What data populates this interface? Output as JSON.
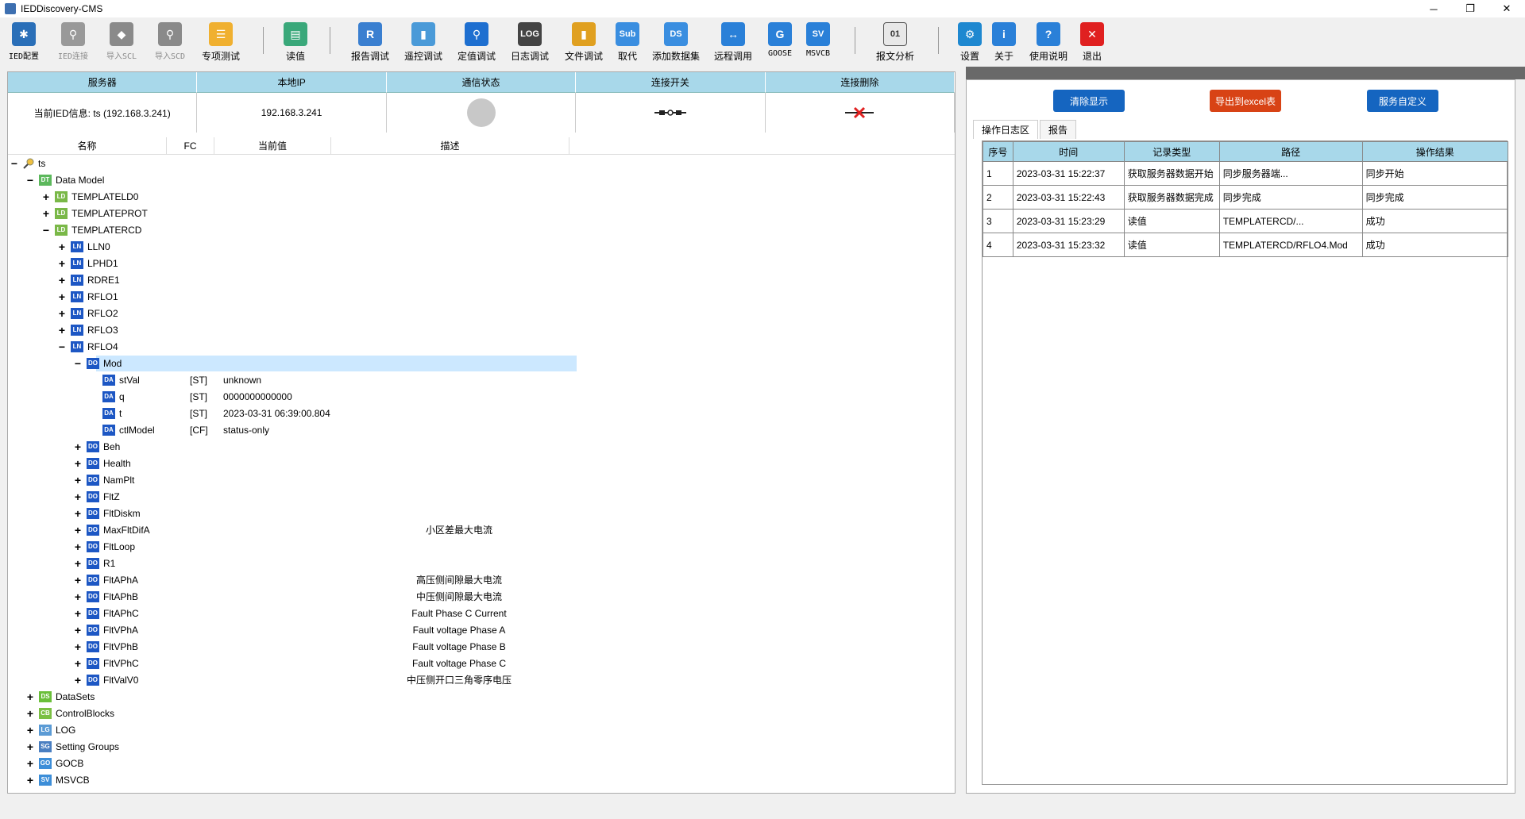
{
  "window": {
    "title": "IEDDiscovery-CMS",
    "min": "─",
    "max": "❐",
    "close": "✕"
  },
  "toolbar": [
    {
      "label": "IED配置",
      "icon": "ied-config-icon",
      "color": "#2a6fb8",
      "glyph": "✱",
      "enabled": true,
      "mono": true
    },
    {
      "label": "IED连接",
      "icon": "ied-connect-icon",
      "color": "#999999",
      "glyph": "⚲",
      "enabled": false,
      "mono": true
    },
    {
      "label": "导入SCL",
      "icon": "import-scl-icon",
      "color": "#8a8a8a",
      "glyph": "◆",
      "enabled": false,
      "mono": true
    },
    {
      "label": "导入SCD",
      "icon": "import-scd-icon",
      "color": "#8a8a8a",
      "glyph": "⚲",
      "enabled": false,
      "mono": true
    },
    {
      "label": "专项测试",
      "icon": "special-test-icon",
      "color": "#f0b030",
      "glyph": "☰",
      "enabled": true,
      "mono": false
    },
    {
      "label": "读值",
      "icon": "read-value-icon",
      "color": "#3aa87a",
      "glyph": "▤",
      "enabled": true,
      "mono": false
    },
    {
      "label": "报告调试",
      "icon": "report-debug-icon",
      "color": "#3a7fd0",
      "glyph": "R",
      "enabled": true,
      "mono": false
    },
    {
      "label": "遥控调试",
      "icon": "remote-control-icon",
      "color": "#4a9ad8",
      "glyph": "▮",
      "enabled": true,
      "mono": false
    },
    {
      "label": "定值调试",
      "icon": "setting-value-icon",
      "color": "#1e6fd0",
      "glyph": "⚲",
      "enabled": true,
      "mono": false
    },
    {
      "label": "日志调试",
      "icon": "log-debug-icon",
      "color": "#444444",
      "glyph": "LOG",
      "enabled": true,
      "mono": false
    },
    {
      "label": "文件调试",
      "icon": "file-debug-icon",
      "color": "#e0a020",
      "glyph": "▮",
      "enabled": true,
      "mono": false
    },
    {
      "label": "取代",
      "icon": "substitute-icon",
      "color": "#3a8ee0",
      "glyph": "Sub",
      "enabled": true,
      "mono": false
    },
    {
      "label": "添加数据集",
      "icon": "add-dataset-icon",
      "color": "#3a8ee0",
      "glyph": "DS",
      "enabled": true,
      "mono": false
    },
    {
      "label": "远程调用",
      "icon": "remote-call-icon",
      "color": "#2a80d8",
      "glyph": "↔",
      "enabled": true,
      "mono": false
    },
    {
      "label": "GOOSE",
      "icon": "goose-icon",
      "color": "#2a80d8",
      "glyph": "G",
      "enabled": true,
      "mono": true
    },
    {
      "label": "MSVCB",
      "icon": "msvcb-icon",
      "color": "#2a80d8",
      "glyph": "SV",
      "enabled": true,
      "mono": true
    },
    {
      "label": "报文分析",
      "icon": "message-analysis-icon",
      "color": "#e8e8e8",
      "glyph": "01",
      "enabled": true,
      "mono": false
    },
    {
      "label": "设置",
      "icon": "settings-icon",
      "color": "#1e88d0",
      "glyph": "⚙",
      "enabled": true,
      "mono": false
    },
    {
      "label": "关于",
      "icon": "about-icon",
      "color": "#2a80d8",
      "glyph": "i",
      "enabled": true,
      "mono": false
    },
    {
      "label": "使用说明",
      "icon": "help-icon",
      "color": "#2a80d8",
      "glyph": "?",
      "enabled": true,
      "mono": false
    },
    {
      "label": "退出",
      "icon": "exit-icon",
      "color": "#e02020",
      "glyph": "✕",
      "enabled": true,
      "mono": false
    }
  ],
  "connection": {
    "headers": [
      "服务器",
      "本地IP",
      "通信状态",
      "连接开关",
      "连接删除"
    ],
    "server": "当前IED信息: ts (192.168.3.241)",
    "local_ip": "192.168.3.241"
  },
  "tree_headers": [
    "名称",
    "FC",
    "当前值",
    "描述"
  ],
  "tree": [
    {
      "level": 0,
      "exp": "−",
      "badge": "",
      "name": "ts"
    },
    {
      "level": 1,
      "exp": "−",
      "badge": "DT",
      "name": "Data Model"
    },
    {
      "level": 2,
      "exp": "+",
      "badge": "LD",
      "name": "TEMPLATELD0"
    },
    {
      "level": 2,
      "exp": "+",
      "badge": "LD",
      "name": "TEMPLATEPROT"
    },
    {
      "level": 2,
      "exp": "−",
      "badge": "LD",
      "name": "TEMPLATERCD"
    },
    {
      "level": 3,
      "exp": "+",
      "badge": "LN",
      "name": "LLN0"
    },
    {
      "level": 3,
      "exp": "+",
      "badge": "LN",
      "name": "LPHD1"
    },
    {
      "level": 3,
      "exp": "+",
      "badge": "LN",
      "name": "RDRE1"
    },
    {
      "level": 3,
      "exp": "+",
      "badge": "LN",
      "name": "RFLO1"
    },
    {
      "level": 3,
      "exp": "+",
      "badge": "LN",
      "name": "RFLO2"
    },
    {
      "level": 3,
      "exp": "+",
      "badge": "LN",
      "name": "RFLO3"
    },
    {
      "level": 3,
      "exp": "−",
      "badge": "LN",
      "name": "RFLO4"
    },
    {
      "level": 4,
      "exp": "−",
      "badge": "DO",
      "name": "Mod",
      "selected": true
    },
    {
      "level": 5,
      "exp": "",
      "badge": "DA",
      "name": "stVal",
      "fc": "[ST]",
      "val": "unknown"
    },
    {
      "level": 5,
      "exp": "",
      "badge": "DA",
      "name": "q",
      "fc": "[ST]",
      "val": "0000000000000"
    },
    {
      "level": 5,
      "exp": "",
      "badge": "DA",
      "name": "t",
      "fc": "[ST]",
      "val": "2023-03-31 06:39:00.804"
    },
    {
      "level": 5,
      "exp": "",
      "badge": "DA",
      "name": "ctlModel",
      "fc": "[CF]",
      "val": "status-only"
    },
    {
      "level": 4,
      "exp": "+",
      "badge": "DO",
      "name": "Beh"
    },
    {
      "level": 4,
      "exp": "+",
      "badge": "DO",
      "name": "Health"
    },
    {
      "level": 4,
      "exp": "+",
      "badge": "DO",
      "name": "NamPlt"
    },
    {
      "level": 4,
      "exp": "+",
      "badge": "DO",
      "name": "FltZ"
    },
    {
      "level": 4,
      "exp": "+",
      "badge": "DO",
      "name": "FltDiskm"
    },
    {
      "level": 4,
      "exp": "+",
      "badge": "DO",
      "name": "MaxFltDifA",
      "desc": "小区差最大电流"
    },
    {
      "level": 4,
      "exp": "+",
      "badge": "DO",
      "name": "FltLoop"
    },
    {
      "level": 4,
      "exp": "+",
      "badge": "DO",
      "name": "R1"
    },
    {
      "level": 4,
      "exp": "+",
      "badge": "DO",
      "name": "FltAPhA",
      "desc": "高压侧间隙最大电流"
    },
    {
      "level": 4,
      "exp": "+",
      "badge": "DO",
      "name": "FltAPhB",
      "desc": "中压侧间隙最大电流"
    },
    {
      "level": 4,
      "exp": "+",
      "badge": "DO",
      "name": "FltAPhC",
      "desc": "Fault Phase C Current"
    },
    {
      "level": 4,
      "exp": "+",
      "badge": "DO",
      "name": "FltVPhA",
      "desc": "Fault voltage Phase A"
    },
    {
      "level": 4,
      "exp": "+",
      "badge": "DO",
      "name": "FltVPhB",
      "desc": "Fault voltage Phase B"
    },
    {
      "level": 4,
      "exp": "+",
      "badge": "DO",
      "name": "FltVPhC",
      "desc": "Fault voltage Phase C"
    },
    {
      "level": 4,
      "exp": "+",
      "badge": "DO",
      "name": "FltValV0",
      "desc": "中压侧开口三角零序电压"
    },
    {
      "level": 1,
      "exp": "+",
      "badge": "DS",
      "name": "DataSets"
    },
    {
      "level": 1,
      "exp": "+",
      "badge": "CB",
      "name": "ControlBlocks"
    },
    {
      "level": 1,
      "exp": "+",
      "badge": "LG",
      "name": "LOG"
    },
    {
      "level": 1,
      "exp": "+",
      "badge": "SG",
      "name": "Setting Groups"
    },
    {
      "level": 1,
      "exp": "+",
      "badge": "GO",
      "name": "GOCB"
    },
    {
      "level": 1,
      "exp": "+",
      "badge": "SV",
      "name": "MSVCB"
    }
  ],
  "right_panel": {
    "clear_button": "清除显示",
    "export_button": "导出到excel表",
    "custom_button": "服务自定义",
    "tabs": [
      "操作日志区",
      "报告"
    ],
    "log_headers": [
      "序号",
      "时间",
      "记录类型",
      "路径",
      "操作结果"
    ],
    "log_rows": [
      [
        "1",
        "2023-03-31 15:22:37",
        "获取服务器数据开始",
        "同步服务器端...",
        "同步开始"
      ],
      [
        "2",
        "2023-03-31 15:22:43",
        "获取服务器数据完成",
        "同步完成",
        "同步完成"
      ],
      [
        "3",
        "2023-03-31 15:23:29",
        "读值",
        "TEMPLATERCD/...",
        "成功"
      ],
      [
        "4",
        "2023-03-31 15:23:32",
        "读值",
        "TEMPLATERCD/RFLO4.Mod",
        "成功"
      ]
    ]
  },
  "colors": {
    "header_blue": "#a8d8ea",
    "clear_btn": "#1565c0",
    "export_btn": "#d84315",
    "custom_btn": "#1565c0"
  }
}
